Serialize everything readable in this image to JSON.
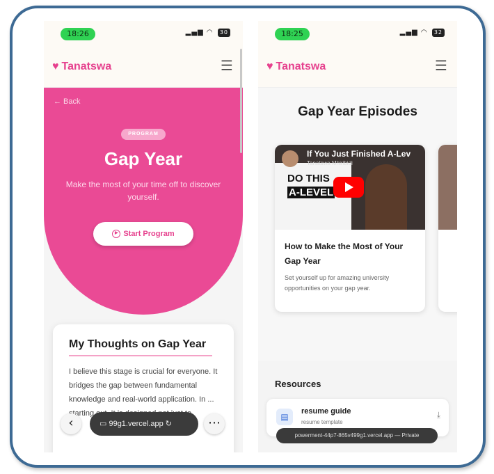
{
  "left_phone": {
    "status": {
      "time": "18:26",
      "battery": "30"
    },
    "brand": "Tanatswa",
    "back_label": "← Back",
    "badge": "PROGRAM",
    "title": "Gap Year",
    "subtitle": "Make the most of your time off to discover yourself.",
    "start_button": "Start Program",
    "thoughts": {
      "title": "My Thoughts on Gap Year",
      "body": "I believe this stage is crucial for everyone. It bridges the gap between fundamental knowledge and real-world application. In ... starting out. It is designed not just to"
    },
    "browser": {
      "url": "99g1.vercel.app",
      "back_icon": "chevron-left-icon",
      "more_icon": "more-icon"
    }
  },
  "right_phone": {
    "status": {
      "time": "18:25",
      "battery": "32"
    },
    "brand": "Tanatswa",
    "episodes_title": "Gap Year Episodes",
    "episode": {
      "thumb_title": "If You Just Finished A-Lev",
      "thumb_channel": "Tanatswa Mhiribidi",
      "thumb_text1": "DO THIS",
      "thumb_text2": "A-LEVEL",
      "title": "How to Make the Most of Your Gap Year",
      "description": "Set yourself up for amazing university opportunities on your gap year."
    },
    "resources_title": "Resources",
    "resource": {
      "name": "resume guide",
      "subtitle": "resume template"
    },
    "url_toast": "powerment-44p7-865v499g1.vercel.app — Private"
  },
  "colors": {
    "brand_pink": "#e6418e",
    "hero_pink": "#ea4a95",
    "frame_blue": "#3d6a94",
    "status_green": "#2fd253"
  }
}
